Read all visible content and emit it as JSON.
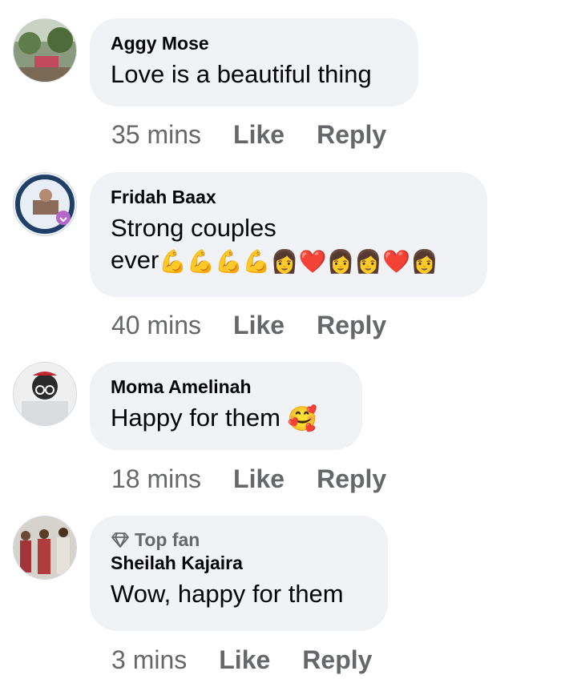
{
  "comments": [
    {
      "name": "Aggy Mose",
      "text": "Love is a beautiful thing",
      "time": "35 mins",
      "like": "Like",
      "reply": "Reply",
      "avatar": "landscape-photo"
    },
    {
      "name": "Fridah Baax",
      "text_line1": "Strong couples",
      "text_line2": "ever",
      "emojis": "💪💪💪💪👩❤️👩👩❤️👩",
      "time": "40 mins",
      "like": "Like",
      "reply": "Reply",
      "avatar": "vaccine-frame-photo"
    },
    {
      "name": "Moma Amelinah",
      "text": "Happy for them",
      "emoji": "🥰",
      "time": "18 mins",
      "like": "Like",
      "reply": "Reply",
      "avatar": "february-girl-illustration"
    },
    {
      "badge": "Top fan",
      "badge_icon": "diamond-icon",
      "name": "Sheilah Kajaira",
      "text": "Wow, happy for them",
      "time": "3 mins",
      "like": "Like",
      "reply": "Reply",
      "avatar": "group-photo"
    }
  ]
}
